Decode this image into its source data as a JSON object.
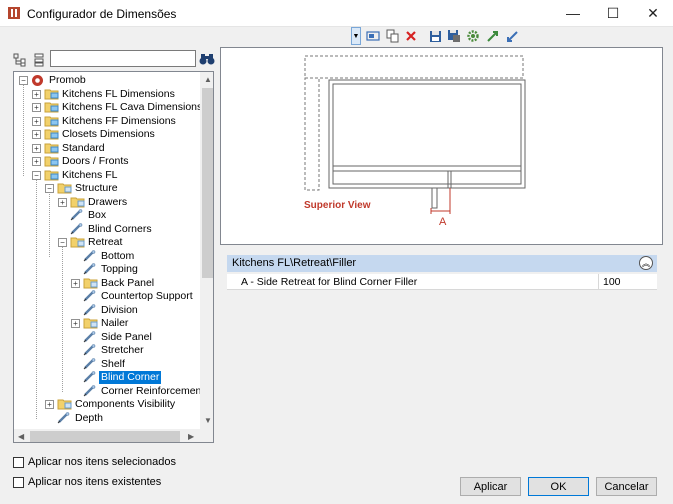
{
  "window": {
    "title": "Configurador de Dimensões",
    "minimize": "—",
    "maximize": "☐",
    "close": "✕"
  },
  "toolbar": {
    "buttons": [
      {
        "icon": "add-attribute-icon",
        "color": "#3b6fb6"
      },
      {
        "icon": "copy-icon",
        "color": "#5a5a5a"
      },
      {
        "icon": "delete-icon",
        "color": "#d62222"
      },
      {
        "icon": "save-icon",
        "color": "#2f5f9e"
      },
      {
        "icon": "save-as-icon",
        "color": "#2f5f9e"
      },
      {
        "icon": "settings-icon",
        "color": "#4a8a3a"
      },
      {
        "icon": "import-icon",
        "color": "#3c8a3c"
      },
      {
        "icon": "export-icon",
        "color": "#3b6fb6"
      }
    ]
  },
  "search": {
    "value": "",
    "placeholder": ""
  },
  "tree": {
    "items": [
      {
        "label": "Promob",
        "level": 0,
        "expander": "−",
        "icon": "promob-logo-icon"
      },
      {
        "label": "Kitchens FL Dimensions",
        "level": 1,
        "expander": "+",
        "icon": "dimension-folder-icon"
      },
      {
        "label": "Kitchens FL Cava Dimensions",
        "level": 1,
        "expander": "+",
        "icon": "dimension-folder-icon"
      },
      {
        "label": "Kitchens FF Dimensions",
        "level": 1,
        "expander": "+",
        "icon": "dimension-folder-icon"
      },
      {
        "label": "Closets Dimensions",
        "level": 1,
        "expander": "+",
        "icon": "dimension-folder-icon"
      },
      {
        "label": "Standard",
        "level": 1,
        "expander": "+",
        "icon": "dimension-folder-icon"
      },
      {
        "label": "Doors / Fronts",
        "level": 1,
        "expander": "+",
        "icon": "dimension-folder-icon"
      },
      {
        "label": "Kitchens FL",
        "level": 1,
        "expander": "−",
        "icon": "dimension-folder-icon"
      },
      {
        "label": "Structure",
        "level": 2,
        "expander": "−",
        "icon": "folder-icon"
      },
      {
        "label": "Drawers",
        "level": 3,
        "expander": "+",
        "icon": "folder-icon"
      },
      {
        "label": "Box",
        "level": 3,
        "expander": "",
        "icon": "dimension-item-icon"
      },
      {
        "label": "Blind Corners",
        "level": 3,
        "expander": "",
        "icon": "dimension-item-icon"
      },
      {
        "label": "Retreat",
        "level": 3,
        "expander": "−",
        "icon": "folder-icon"
      },
      {
        "label": "Bottom",
        "level": 4,
        "expander": "",
        "icon": "dimension-item-icon"
      },
      {
        "label": "Topping",
        "level": 4,
        "expander": "",
        "icon": "dimension-item-icon"
      },
      {
        "label": "Back Panel",
        "level": 4,
        "expander": "+",
        "icon": "folder-icon"
      },
      {
        "label": "Countertop Support",
        "level": 4,
        "expander": "",
        "icon": "dimension-item-icon"
      },
      {
        "label": "Division",
        "level": 4,
        "expander": "",
        "icon": "dimension-item-icon"
      },
      {
        "label": "Nailer",
        "level": 4,
        "expander": "+",
        "icon": "folder-icon"
      },
      {
        "label": "Side Panel",
        "level": 4,
        "expander": "",
        "icon": "dimension-item-icon"
      },
      {
        "label": "Stretcher",
        "level": 4,
        "expander": "",
        "icon": "dimension-item-icon"
      },
      {
        "label": "Shelf",
        "level": 4,
        "expander": "",
        "icon": "dimension-item-icon"
      },
      {
        "label": "Blind Corner",
        "level": 4,
        "expander": "",
        "icon": "dimension-item-icon",
        "selected": true
      },
      {
        "label": "Corner Reinforcement",
        "level": 4,
        "expander": "",
        "icon": "dimension-item-icon"
      },
      {
        "label": "Components Visibility",
        "level": 2,
        "expander": "+",
        "icon": "folder-icon"
      },
      {
        "label": "Depth",
        "level": 2,
        "expander": "",
        "icon": "dimension-item-icon"
      }
    ]
  },
  "preview": {
    "view_label": "Superior View",
    "dimension_label": "A"
  },
  "properties": {
    "group_title": "Kitchens FL\\Retreat\\Filler",
    "rows": [
      {
        "name": "A - Side Retreat for Blind Corner Filler",
        "value": "100"
      }
    ]
  },
  "options": {
    "apply_selected": "Aplicar nos itens selecionados",
    "apply_existing": "Aplicar nos itens existentes"
  },
  "buttons": {
    "apply": "Aplicar",
    "ok": "OK",
    "cancel": "Cancelar"
  },
  "colors": {
    "selection": "#0078d7",
    "group_header": "#c5d8ef",
    "annotation_red": "#c0392b"
  }
}
